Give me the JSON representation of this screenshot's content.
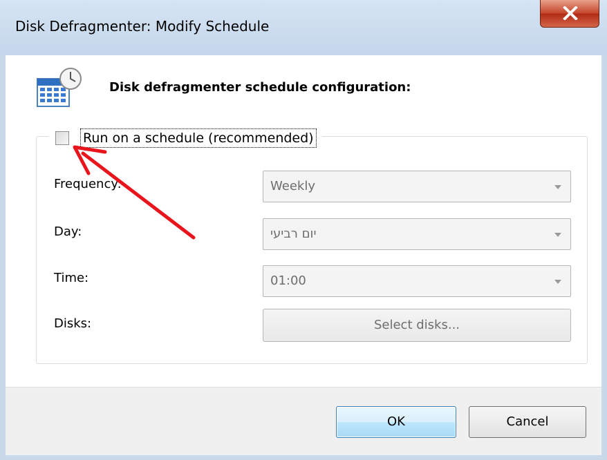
{
  "window": {
    "title": "Disk Defragmenter: Modify Schedule"
  },
  "header": {
    "title": "Disk defragmenter schedule configuration:",
    "icon": "calendar-clock-icon"
  },
  "schedule": {
    "checkbox_label": "Run on a schedule (recommended)",
    "checked": false,
    "frequency": {
      "label": "Frequency:",
      "value": "Weekly"
    },
    "day": {
      "label": "Day:",
      "value": "יום רביעי"
    },
    "time": {
      "label": "Time:",
      "value": "01:00"
    },
    "disks": {
      "label": "Disks:",
      "button_label": "Select disks..."
    }
  },
  "footer": {
    "ok_label": "OK",
    "cancel_label": "Cancel"
  },
  "colors": {
    "annotation_arrow": "#e8161c",
    "close_button": "#c4442a"
  }
}
